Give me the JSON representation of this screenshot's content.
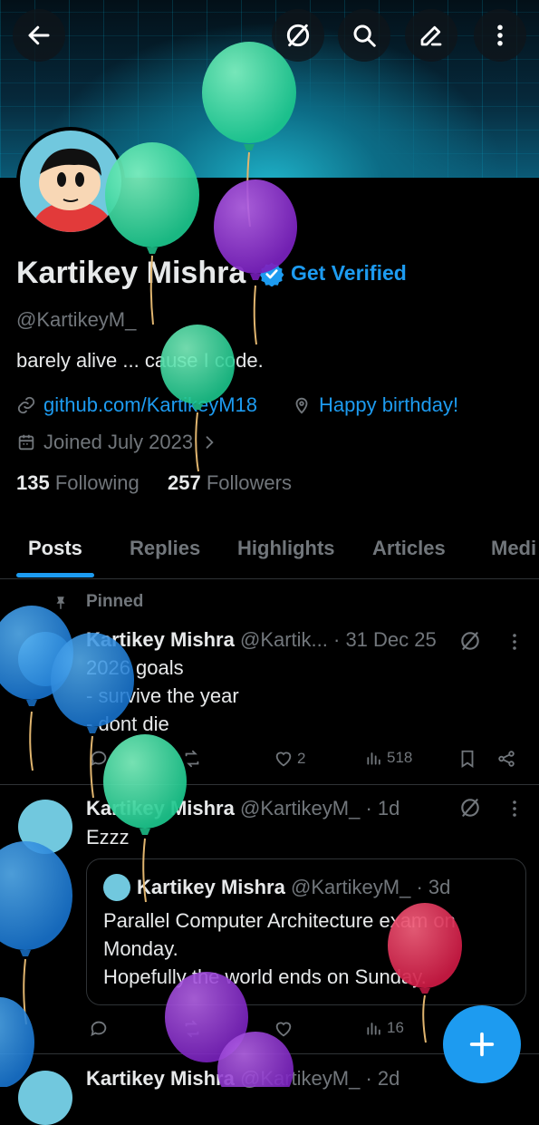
{
  "colors": {
    "accent": "#1d9bf0",
    "background": "#000000",
    "muted": "#71767b",
    "text": "#e7e9ea"
  },
  "header": {
    "icons": [
      "back-arrow-icon",
      "grok-icon",
      "search-icon",
      "edit-icon",
      "more-icon"
    ]
  },
  "profile": {
    "name": "Kartikey Mishra",
    "get_verified": "Get Verified",
    "handle": "@KartikeyM_",
    "bio": "barely alive ... cause I code.",
    "link": "github.com/KartikeyM18",
    "location": "Happy birthday!",
    "joined": "Joined July 2023",
    "following_count": "135",
    "following_label": "Following",
    "followers_count": "257",
    "followers_label": "Followers"
  },
  "tabs": [
    "Posts",
    "Replies",
    "Highlights",
    "Articles",
    "Medi"
  ],
  "posts": [
    {
      "pinned_label": "Pinned",
      "name": "Kartikey Mishra",
      "handle_time": "@Kartik... · 31 Dec 25",
      "lines": [
        "2026 goals",
        "- survive the year",
        "- dont die"
      ],
      "likes": "2",
      "views": "518"
    },
    {
      "name": "Kartikey Mishra",
      "handle_time": "@KartikeyM_ · 1d",
      "lines": [
        "Ezzz"
      ],
      "quote": {
        "name": "Kartikey Mishra",
        "handle_time": "@KartikeyM_ · 3d",
        "lines": [
          "Parallel Computer Architecture exam on",
          "Monday.",
          "Hopefully the world ends on Sunday."
        ]
      },
      "views": "16"
    },
    {
      "name": "Kartikey Mishra",
      "handle_time": "@KartikeyM_ · 2d"
    }
  ]
}
